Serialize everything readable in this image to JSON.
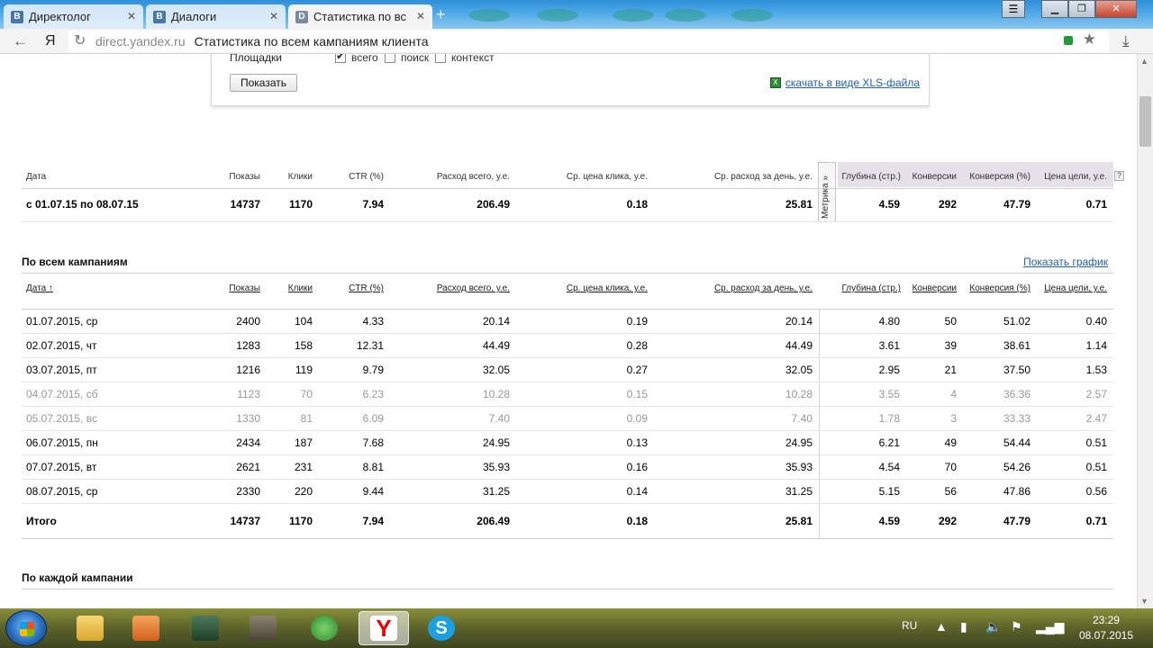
{
  "browser": {
    "tabs": [
      {
        "title": "Директолог",
        "favicon": "vk-icon"
      },
      {
        "title": "Диалоги",
        "favicon": "vk-icon"
      },
      {
        "title": "Статистика по вс",
        "favicon": "direct-icon"
      }
    ],
    "new_tab": "+",
    "url_domain": "direct.yandex.ru",
    "page_title": "Статистика по всем кампаниям клиента",
    "back_icon": "back-arrow-icon",
    "logo": "Я",
    "download_icon": "download-icon"
  },
  "filter": {
    "platforms_label": "Площадки",
    "options": [
      {
        "label": "всего",
        "checked": true
      },
      {
        "label": "поиск",
        "checked": false
      },
      {
        "label": "контекст",
        "checked": false
      }
    ],
    "show_button": "Показать",
    "xls_link": "скачать в виде XLS-файла"
  },
  "summary": {
    "headers": [
      "Дата",
      "Показы",
      "Клики",
      "CTR (%)",
      "Расход всего, у.е.",
      "Ср. цена клика, у.е.",
      "Ср. расход за день, у.е.",
      "Глубина (стр.)",
      "Конверсии",
      "Конверсия (%)",
      "Цена цели, у.е."
    ],
    "metrika_label": "Метрика »",
    "help": "?",
    "row": [
      "с 01.07.15 по 08.07.15",
      "14737",
      "1170",
      "7.94",
      "206.49",
      "0.18",
      "25.81",
      "4.59",
      "292",
      "47.79",
      "0.71"
    ]
  },
  "all_campaigns": {
    "title": "По всем кампаниям",
    "show_graph": "Показать график",
    "headers": [
      "Дата ↑",
      "Показы",
      "Клики",
      "CTR (%)",
      "Расход всего, у.е.",
      "Ср. цена клика, у.е.",
      "Ср. расход за день, у.е.",
      "Глубина (стр.)",
      "Конверсии",
      "Конверсия (%)",
      "Цена цели, у.е."
    ],
    "rows": [
      [
        "01.07.2015, ср",
        "2400",
        "104",
        "4.33",
        "20.14",
        "0.19",
        "20.14",
        "4.80",
        "50",
        "51.02",
        "0.40"
      ],
      [
        "02.07.2015, чт",
        "1283",
        "158",
        "12.31",
        "44.49",
        "0.28",
        "44.49",
        "3.61",
        "39",
        "38.61",
        "1.14"
      ],
      [
        "03.07.2015, пт",
        "1216",
        "119",
        "9.79",
        "32.05",
        "0.27",
        "32.05",
        "2.95",
        "21",
        "37.50",
        "1.53"
      ],
      [
        "04.07.2015, сб",
        "1123",
        "70",
        "6.23",
        "10.28",
        "0.15",
        "10.28",
        "3.55",
        "4",
        "36.36",
        "2.57"
      ],
      [
        "05.07.2015, вс",
        "1330",
        "81",
        "6.09",
        "7.40",
        "0.09",
        "7.40",
        "1.78",
        "3",
        "33.33",
        "2.47"
      ],
      [
        "06.07.2015, пн",
        "2434",
        "187",
        "7.68",
        "24.95",
        "0.13",
        "24.95",
        "6.21",
        "49",
        "54.44",
        "0.51"
      ],
      [
        "07.07.2015, вт",
        "2621",
        "231",
        "8.81",
        "35.93",
        "0.16",
        "35.93",
        "4.54",
        "70",
        "54.26",
        "0.51"
      ],
      [
        "08.07.2015, ср",
        "2330",
        "220",
        "9.44",
        "31.25",
        "0.14",
        "31.25",
        "5.15",
        "56",
        "47.86",
        "0.56"
      ]
    ],
    "weekend_rows": [
      3,
      4
    ],
    "total": [
      "Итого",
      "14737",
      "1170",
      "7.94",
      "206.49",
      "0.18",
      "25.81",
      "4.59",
      "292",
      "47.79",
      "0.71"
    ]
  },
  "each_campaign": {
    "title": "По каждой кампании"
  },
  "taskbar": {
    "apps": [
      "explorer-icon",
      "media-player-icon",
      "task-manager-icon",
      "gimp-icon",
      "download-master-icon",
      "yandex-browser-icon",
      "skype-icon"
    ],
    "lang": "RU",
    "time": "23:29",
    "date": "08.07.2015"
  },
  "colors": {
    "link": "#1f5fb5",
    "muted": "#999999",
    "metrika_bg": "#e4e1e8"
  }
}
